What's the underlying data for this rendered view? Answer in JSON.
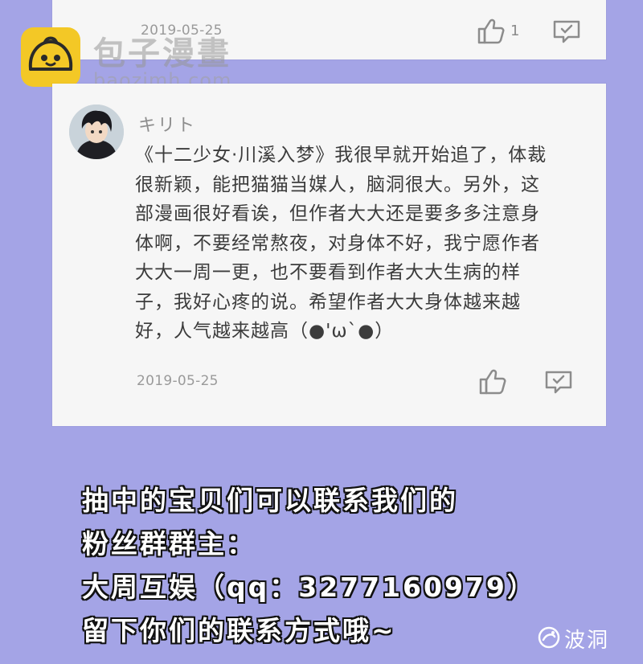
{
  "top_comment": {
    "date": "2019-05-25",
    "like_count": "1"
  },
  "watermark_top": {
    "name": "包子漫畫",
    "url": "baozimh.com"
  },
  "main_comment": {
    "username": "キリト",
    "lines": [
      "《十二少女·川溪入梦》我很早就开始追了，体裁",
      "很新颖，能把猫猫当媒人，脑洞很大。另外，这",
      "部漫画很好看诶，但作者大大还是要多多注意身",
      "体啊，不要经常熬夜，对身体不好，我宁愿作者",
      "大大一周一更，也不要看到作者大大生病的样",
      "子，我好心疼的说。希望作者大大身体越来越",
      "好，人气越来越高（●'ω`●）"
    ],
    "date": "2019-05-25"
  },
  "announcement": {
    "lines": [
      "抽中的宝贝们可以联系我们的",
      "粉丝群群主：",
      "大周互娱（qq：3277160979）",
      "留下你们的联系方式哦~"
    ]
  },
  "watermark_bottom": {
    "text": "波洞"
  },
  "colors": {
    "background": "#a4a4e6",
    "card": "#f6f6f6",
    "logo_yellow": "#f3c826"
  },
  "icons": [
    "thumbs-up-icon",
    "reply-comment-icon",
    "bun-logo-icon",
    "avatar-image",
    "bodong-logo-icon"
  ]
}
